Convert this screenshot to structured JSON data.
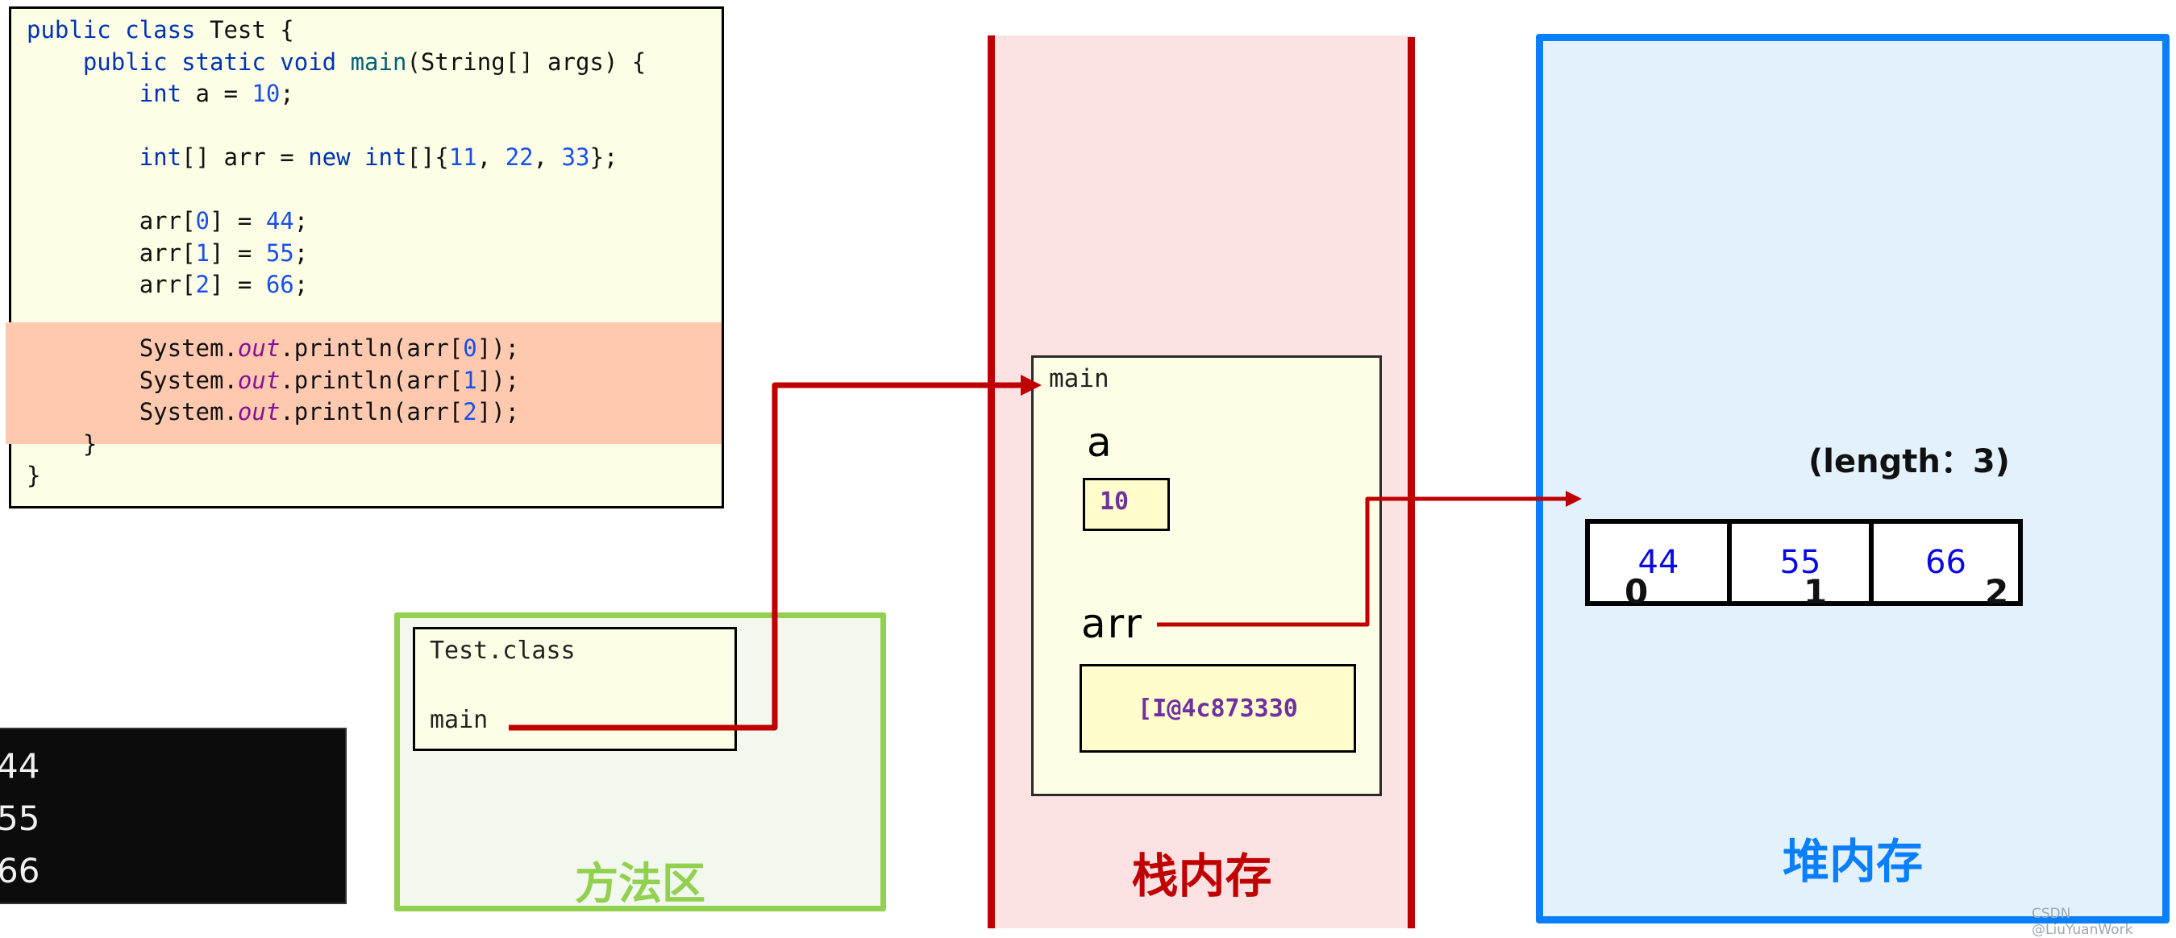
{
  "code": {
    "lines": [
      {
        "indent": 0,
        "tokens": [
          [
            "kw",
            "public "
          ],
          [
            "kw",
            "class "
          ],
          [
            "",
            "Test {"
          ]
        ]
      },
      {
        "indent": 1,
        "tokens": [
          [
            "kw",
            "public "
          ],
          [
            "kw",
            "static "
          ],
          [
            "kw",
            "void "
          ],
          [
            "fn",
            "main"
          ],
          [
            "",
            "(String[] args) {"
          ]
        ]
      },
      {
        "indent": 2,
        "tokens": [
          [
            "kw",
            "int "
          ],
          [
            "",
            "a = "
          ],
          [
            "num",
            "10"
          ],
          [
            "",
            ";"
          ]
        ]
      },
      {
        "indent": 0,
        "tokens": []
      },
      {
        "indent": 2,
        "tokens": [
          [
            "kw",
            "int"
          ],
          [
            "",
            "[] arr = "
          ],
          [
            "kw",
            "new "
          ],
          [
            "kw",
            "int"
          ],
          [
            "",
            "[]{"
          ],
          [
            "num",
            "11"
          ],
          [
            "",
            ", "
          ],
          [
            "num",
            "22"
          ],
          [
            "",
            ", "
          ],
          [
            "num",
            "33"
          ],
          [
            "",
            "};"
          ]
        ]
      },
      {
        "indent": 0,
        "tokens": []
      },
      {
        "indent": 2,
        "tokens": [
          [
            "",
            "arr["
          ],
          [
            "num",
            "0"
          ],
          [
            "",
            "] = "
          ],
          [
            "num",
            "44"
          ],
          [
            "",
            ";"
          ]
        ]
      },
      {
        "indent": 2,
        "tokens": [
          [
            "",
            "arr["
          ],
          [
            "num",
            "1"
          ],
          [
            "",
            "] = "
          ],
          [
            "num",
            "55"
          ],
          [
            "",
            ";"
          ]
        ]
      },
      {
        "indent": 2,
        "tokens": [
          [
            "",
            "arr["
          ],
          [
            "num",
            "2"
          ],
          [
            "",
            "] = "
          ],
          [
            "num",
            "66"
          ],
          [
            "",
            ";"
          ]
        ]
      },
      {
        "indent": 0,
        "tokens": []
      },
      {
        "indent": 2,
        "tokens": [
          [
            "",
            "System."
          ],
          [
            "fld",
            "out"
          ],
          [
            "",
            ".println(arr["
          ],
          [
            "num",
            "0"
          ],
          [
            "",
            "]);"
          ]
        ]
      },
      {
        "indent": 2,
        "tokens": [
          [
            "",
            "System."
          ],
          [
            "fld",
            "out"
          ],
          [
            "",
            ".println(arr["
          ],
          [
            "num",
            "1"
          ],
          [
            "",
            "]);"
          ]
        ]
      },
      {
        "indent": 2,
        "tokens": [
          [
            "",
            "System."
          ],
          [
            "fld",
            "out"
          ],
          [
            "",
            ".println(arr["
          ],
          [
            "num",
            "2"
          ],
          [
            "",
            "]);"
          ]
        ]
      },
      {
        "indent": 1,
        "tokens": [
          [
            "",
            "}"
          ]
        ]
      },
      {
        "indent": 0,
        "tokens": [
          [
            "",
            "}"
          ]
        ]
      }
    ],
    "highlighted_lines": [
      10,
      11,
      12
    ]
  },
  "console": {
    "output": [
      "44",
      "55",
      "66"
    ]
  },
  "method_area": {
    "label": "方法区",
    "class_name": "Test.class",
    "method_name": "main"
  },
  "stack": {
    "label": "栈内存",
    "frame_name": "main",
    "vars": {
      "a": {
        "name": "a",
        "value": "10"
      },
      "arr": {
        "name": "arr",
        "value": "[I@4c873330"
      }
    }
  },
  "heap": {
    "label": "堆内存",
    "array": {
      "length_label": "(length：3)",
      "values": [
        "44",
        "55",
        "66"
      ],
      "indices": [
        "0",
        "1",
        "2"
      ]
    }
  },
  "colors": {
    "stack_red": "#c00000",
    "method_green": "#92d050",
    "heap_blue": "#0a7ffc",
    "value_purple": "#7030a0",
    "highlight": "#ffc9b0"
  },
  "watermark": "CSDN @LiuYuanWork"
}
